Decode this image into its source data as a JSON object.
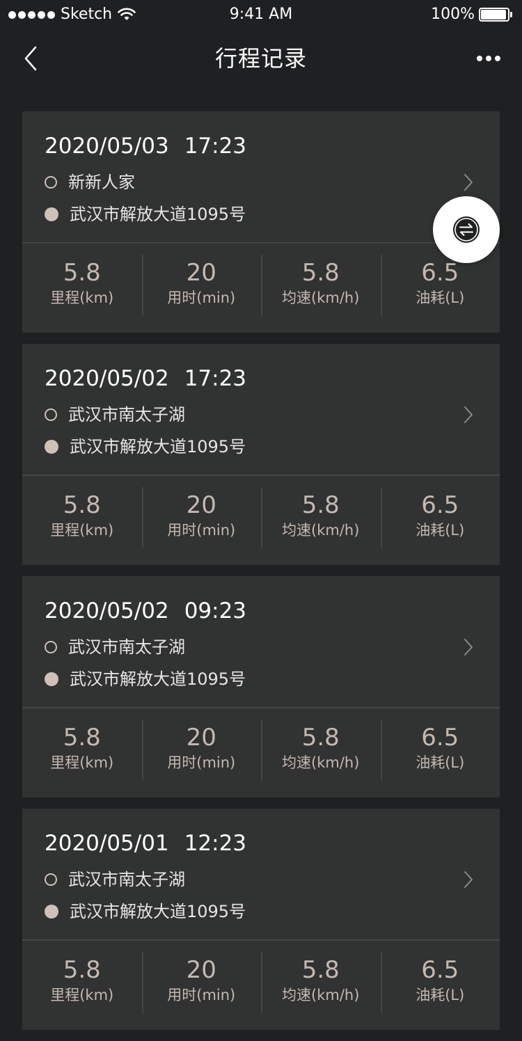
{
  "status_bar": {
    "carrier": "Sketch",
    "time": "9:41 AM",
    "battery": "100%"
  },
  "nav": {
    "title": "行程记录"
  },
  "stat_labels": {
    "distance": "里程(km)",
    "duration": "用时(min)",
    "speed": "均速(km/h)",
    "fuel": "油耗(L)"
  },
  "trips": [
    {
      "date": "2020/05/03",
      "time": "17:23",
      "start": "新新人家",
      "end": "武汉市解放大道1095号",
      "distance": "5.8",
      "duration": "20",
      "speed": "5.8",
      "fuel": "6.5"
    },
    {
      "date": "2020/05/02",
      "time": "17:23",
      "start": "武汉市南太子湖",
      "end": "武汉市解放大道1095号",
      "distance": "5.8",
      "duration": "20",
      "speed": "5.8",
      "fuel": "6.5"
    },
    {
      "date": "2020/05/02",
      "time": "09:23",
      "start": "武汉市南太子湖",
      "end": "武汉市解放大道1095号",
      "distance": "5.8",
      "duration": "20",
      "speed": "5.8",
      "fuel": "6.5"
    },
    {
      "date": "2020/05/01",
      "time": "12:23",
      "start": "武汉市南太子湖",
      "end": "武汉市解放大道1095号",
      "distance": "5.8",
      "duration": "20",
      "speed": "5.8",
      "fuel": "6.5"
    }
  ],
  "colors": {
    "background": "#1f2021",
    "card": "#313232",
    "accent": "#cfc1b8",
    "stat_text": "#c5b9b1"
  },
  "icons": {
    "back": "chevron-left-icon",
    "more": "more-dots-icon",
    "row_arrow": "chevron-right-icon",
    "switch": "swap-arrows-icon"
  }
}
